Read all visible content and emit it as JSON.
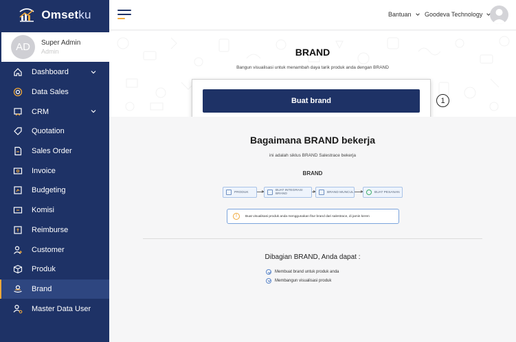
{
  "app": {
    "logo_main": "Omset",
    "logo_suffix": "ku"
  },
  "user": {
    "initials": "AD",
    "name": "Super Admin",
    "role": "Admin"
  },
  "sidebar": {
    "items": [
      {
        "label": "Dashboard",
        "icon": "home-icon",
        "has_chevron": true
      },
      {
        "label": "Data Sales",
        "icon": "target-icon",
        "has_chevron": false
      },
      {
        "label": "CRM",
        "icon": "crm-icon",
        "has_chevron": true
      },
      {
        "label": "Quotation",
        "icon": "tag-icon",
        "has_chevron": false
      },
      {
        "label": "Sales Order",
        "icon": "document-icon",
        "has_chevron": false
      },
      {
        "label": "Invoice",
        "icon": "invoice-icon",
        "has_chevron": false
      },
      {
        "label": "Budgeting",
        "icon": "budget-icon",
        "has_chevron": false
      },
      {
        "label": "Komisi",
        "icon": "commission-icon",
        "has_chevron": false
      },
      {
        "label": "Reimburse",
        "icon": "reimburse-icon",
        "has_chevron": false
      },
      {
        "label": "Customer",
        "icon": "user-add-icon",
        "has_chevron": false
      },
      {
        "label": "Produk",
        "icon": "box-icon",
        "has_chevron": false
      },
      {
        "label": "Brand",
        "icon": "brand-icon",
        "has_chevron": false,
        "active": true
      },
      {
        "label": "Master Data User",
        "icon": "user-settings-icon",
        "has_chevron": false
      }
    ]
  },
  "topbar": {
    "help": "Bantuan",
    "company": "Goodeva Technology"
  },
  "hero": {
    "title": "BRAND",
    "subtitle": "Bangun visualisasi untuk menambah daya tarik produk anda dengan BRAND",
    "button_label": "Buat brand",
    "step_marker": "1"
  },
  "how": {
    "title": "Bagaimana BRAND bekerja",
    "subtitle": "ini adalah siklus BRAND Salestrace bekerja",
    "flow_title": "BRAND",
    "flow": [
      "PRODUK",
      "BUAT INTEGRASI BRAND",
      "BRAND MUNCUL",
      "BUAT PESANAN"
    ],
    "info": "Buat visualisasi produk anda menggunakan fitur brand dari salestrace, di jamin keren"
  },
  "benefits": {
    "title": "Dibagian BRAND, Anda dapat :",
    "items": [
      "Membuat brand untuk produk anda",
      "Membangun visualisasi produk"
    ]
  },
  "colors": {
    "sidebar": "#1e3266",
    "accent": "#f0a839",
    "primary_button": "#1e3266"
  }
}
